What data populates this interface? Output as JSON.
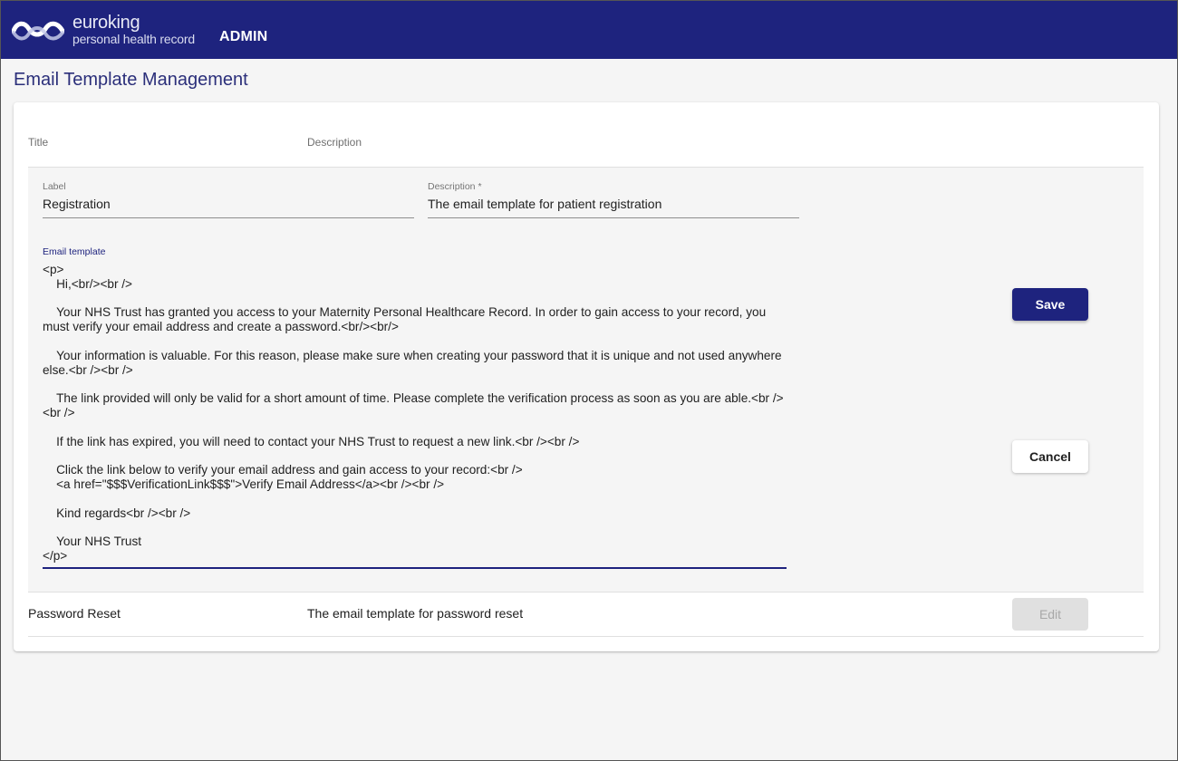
{
  "header": {
    "brand_name": "euroking",
    "brand_sub": "personal health record",
    "section": "ADMIN"
  },
  "page": {
    "title": "Email Template Management"
  },
  "table": {
    "columns": [
      "Title",
      "Description"
    ],
    "expanded_row": {
      "label_field": {
        "label": "Label",
        "value": "Registration"
      },
      "description_field": {
        "label": "Description *",
        "value": "The email template for patient registration"
      },
      "template_field": {
        "label": "Email template",
        "value": "<p>\n    Hi,<br/><br />\n\n    Your NHS Trust has granted you access to your Maternity Personal Healthcare Record. In order to gain access to your record, you must verify your email address and create a password.<br/><br/>\n\n    Your information is valuable. For this reason, please make sure when creating your password that it is unique and not used anywhere else.<br /><br />\n\n    The link provided will only be valid for a short amount of time. Please complete the verification process as soon as you are able.<br /><br />\n\n    If the link has expired, you will need to contact your NHS Trust to request a new link.<br /><br />\n\n    Click the link below to verify your email address and gain access to your record:<br />\n    <a href=\"$$$VerificationLink$$$\">Verify Email Address</a><br /><br />\n\n    Kind regards<br /><br />\n\n    Your NHS Trust\n</p>"
      },
      "save_label": "Save",
      "cancel_label": "Cancel"
    },
    "rows": [
      {
        "title": "Password Reset",
        "description": "The email template for password reset",
        "action_label": "Edit"
      }
    ]
  },
  "colors": {
    "primary": "#1e237e",
    "background": "#f5f5f5",
    "disabled": "#e0e0e0"
  }
}
